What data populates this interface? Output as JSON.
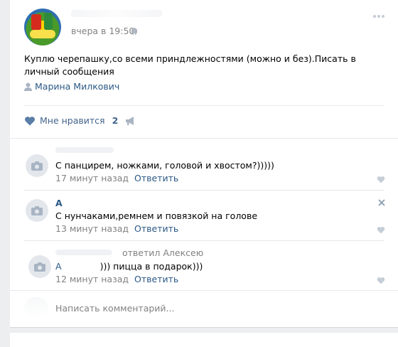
{
  "post": {
    "time": "вчера в 19:50",
    "text": "Куплю черепашку,со всеми приндлежностями (можно и без).Писать в личный сообщения",
    "signer": "Марина Милкович",
    "like_label": "Мне нравится",
    "like_count": "2"
  },
  "comments": [
    {
      "name": "",
      "text": "С панцирем, ножками, головой и хвостом?)))))",
      "time": "17 минут назад",
      "reply": "Ответить"
    },
    {
      "name": "А",
      "text": "С нунчаками,ремнем и повязкой на голове",
      "time": "13 минут назад",
      "reply": "Ответить"
    },
    {
      "reply_to": "ответил Алексею",
      "name": "А",
      "text": "))) пицца в подарок)))",
      "time": "12 минут назад",
      "reply": "Ответить"
    }
  ],
  "composer": {
    "placeholder": "Написать комментарий..."
  },
  "colors": {
    "link": "#2a5885",
    "meta": "#828282",
    "like": "#42648b",
    "background": "#edeef0"
  }
}
